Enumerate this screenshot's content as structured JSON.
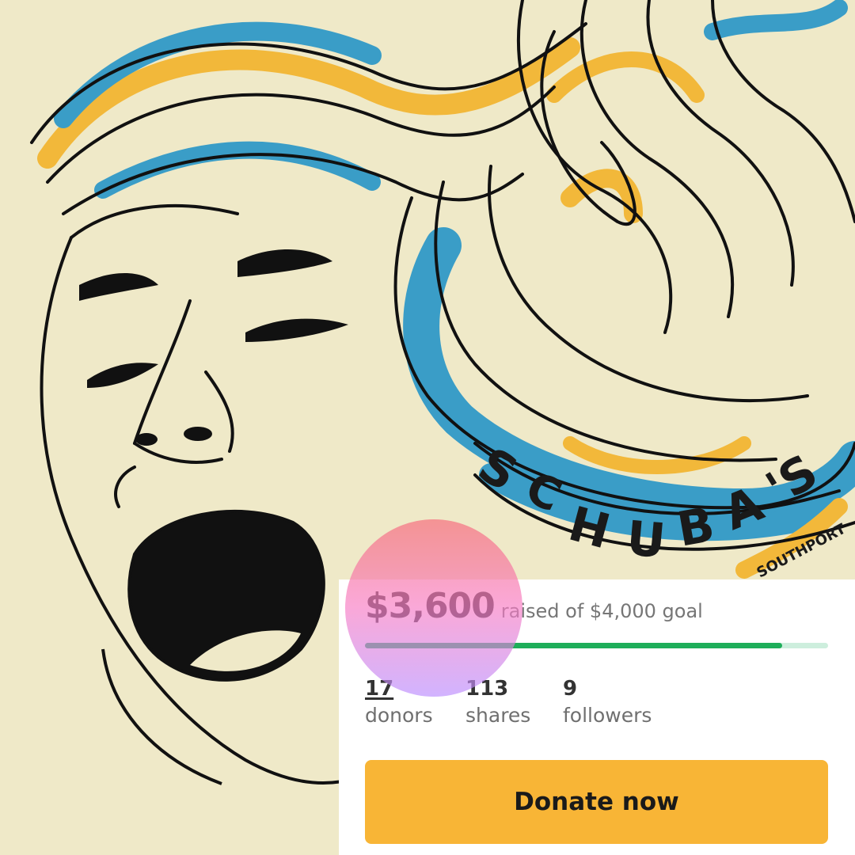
{
  "artwork": {
    "venue_lettering": "SCHUBA'S",
    "location_lettering": "SOUTHPORT"
  },
  "campaign": {
    "raised": "$3,600",
    "goal_text": "raised of $4,000 goal",
    "progress_fraction": 0.9
  },
  "stats": [
    {
      "value": "17",
      "label": "donors"
    },
    {
      "value": "113",
      "label": "shares"
    },
    {
      "value": "9",
      "label": "followers"
    }
  ],
  "donate_label": "Donate now",
  "colors": {
    "primary": "#f8b536",
    "progress": "#1eae5a",
    "background": "#efe9c8",
    "hair_blue": "#3a9dc7",
    "hair_yellow": "#f2b83a"
  }
}
